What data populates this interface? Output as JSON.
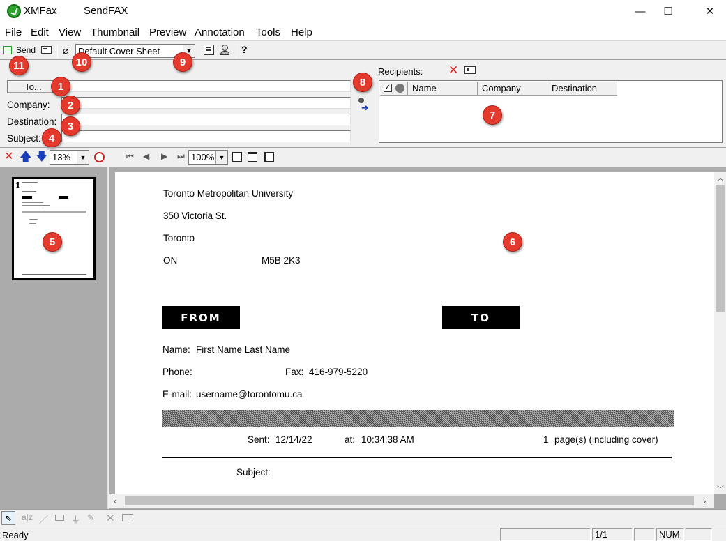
{
  "window": {
    "app_name": "XMFax",
    "title": "SendFAX",
    "minimize": "—",
    "maximize": "☐",
    "close": "✕"
  },
  "menu": [
    "File",
    "Edit",
    "View",
    "Thumbnail",
    "Preview",
    "Annotation",
    "Tools",
    "Help"
  ],
  "toolbar": {
    "send_label": "Send",
    "cover_sheet": "Default Cover Sheet"
  },
  "form": {
    "to_button": "To...",
    "company_label": "Company:",
    "destination_label": "Destination:",
    "subject_label": "Subject:",
    "to_value": "",
    "company_value": "",
    "destination_value": "",
    "subject_value": ""
  },
  "recipients": {
    "label": "Recipients:",
    "columns": [
      "Name",
      "Company",
      "Destination"
    ]
  },
  "preview_toolbar": {
    "thumb_zoom": "13%",
    "page_zoom": "100%"
  },
  "badges": [
    "1",
    "2",
    "3",
    "4",
    "5",
    "6",
    "7",
    "8",
    "9",
    "10",
    "11"
  ],
  "cover": {
    "org": "Toronto Metropolitan University",
    "address": "350 Victoria St.",
    "city": "Toronto",
    "province": "ON",
    "postal": "M5B 2K3",
    "from_label": "FROM",
    "to_label": "TO",
    "name_label": "Name:",
    "name_value": "First Name Last Name",
    "phone_label": "Phone:",
    "fax_label": "Fax:",
    "fax_value": "416-979-5220",
    "email_label": "E-mail:",
    "email_value": "username@torontomu.ca",
    "sent_label": "Sent:",
    "sent_date": "12/14/22",
    "at_label": "at:",
    "sent_time": "10:34:38 AM",
    "pages_count": "1",
    "pages_label": "page(s) (including cover)",
    "subject_label": "Subject:"
  },
  "thumbnail": {
    "page_number": "1"
  },
  "status": {
    "text": "Ready",
    "page": "1/1",
    "num": "NUM"
  }
}
